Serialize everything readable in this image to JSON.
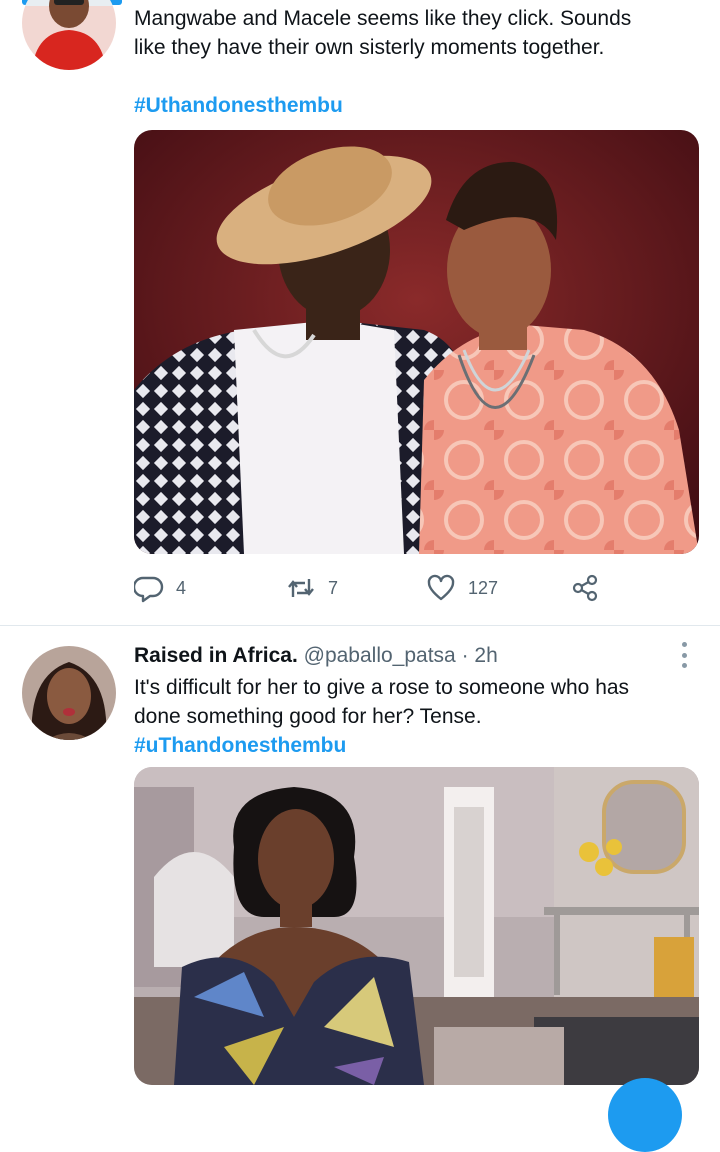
{
  "tweet1": {
    "text_line1": "Mangwabe and Macele seems like they click. Sounds",
    "text_line2": "like they have their own sisterly moments together.",
    "hashtag": "#Uthandonesthembu",
    "image_icon": "photo-two-men-on-stage",
    "reply_count": "4",
    "retweet_count": "7",
    "like_count": "127"
  },
  "tweet2": {
    "display_name": "Raised in Africa.",
    "handle": "@paballo_patsa",
    "separator": "·",
    "time": "2h",
    "text_line1": "It's difficult for her to give a rose to someone who has",
    "text_line2": "done something good for her? Tense.",
    "hashtag": "#uThandonesthembu",
    "image_icon": "photo-woman-reaction"
  },
  "colors": {
    "accent": "#1d9bf0",
    "secondary_text": "#536471",
    "divider": "#e1e8ed"
  }
}
